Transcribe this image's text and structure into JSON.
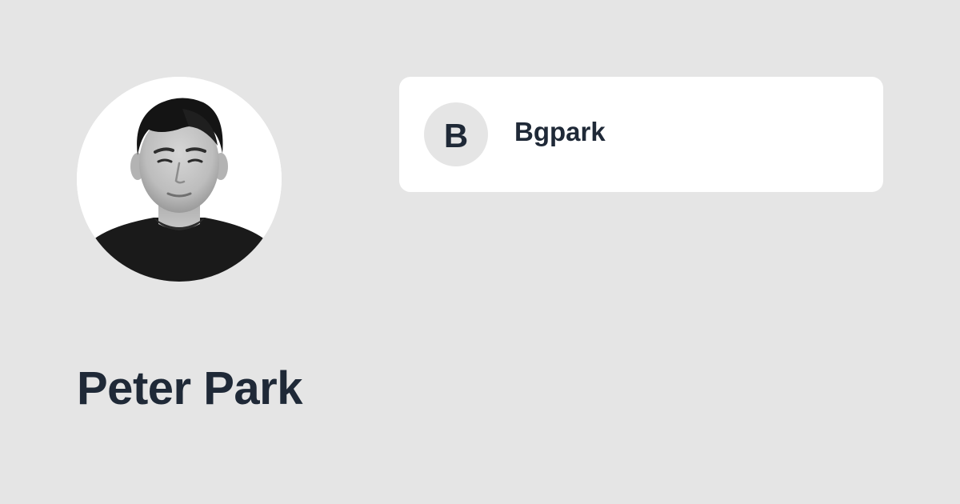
{
  "profile": {
    "name": "Peter Park",
    "avatar_description": "portrait-photo"
  },
  "account": {
    "initial": "B",
    "username": "Bgpark"
  },
  "colors": {
    "background": "#e5e5e5",
    "card": "#ffffff",
    "text": "#1f2937",
    "badge": "#e5e5e5"
  }
}
